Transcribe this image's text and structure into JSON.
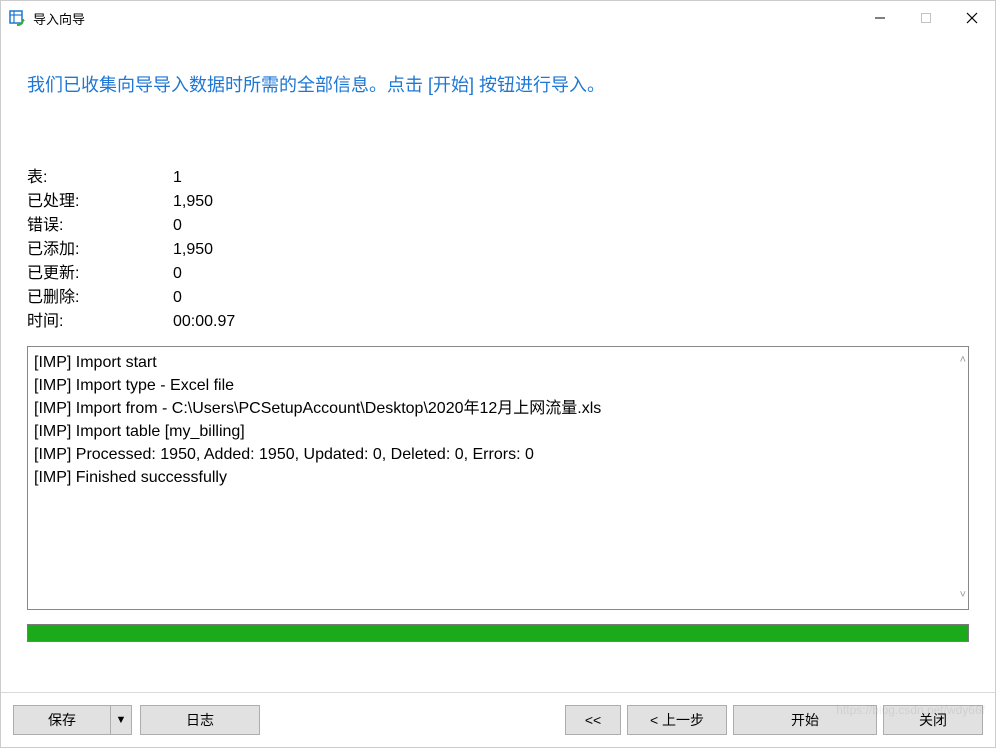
{
  "window": {
    "title": "导入向导"
  },
  "instruction": "我们已收集向导导入数据时所需的全部信息。点击 [开始] 按钮进行导入。",
  "stats": {
    "tables": {
      "label": "表:",
      "value": "1"
    },
    "processed": {
      "label": "已处理:",
      "value": "1,950"
    },
    "errors": {
      "label": "错误:",
      "value": "0"
    },
    "added": {
      "label": "已添加:",
      "value": "1,950"
    },
    "updated": {
      "label": "已更新:",
      "value": "0"
    },
    "deleted": {
      "label": "已删除:",
      "value": "0"
    },
    "time": {
      "label": "时间:",
      "value": "00:00.97"
    }
  },
  "log_lines": [
    "[IMP] Import start",
    "[IMP] Import type - Excel file",
    "[IMP] Import from - C:\\Users\\PCSetupAccount\\Desktop\\2020年12月上网流量.xls",
    "[IMP] Import table [my_billing]",
    "[IMP] Processed: 1950, Added: 1950, Updated: 0, Deleted: 0, Errors: 0",
    "[IMP] Finished successfully"
  ],
  "progress": {
    "percent": 100,
    "color": "#1aaa1a"
  },
  "buttons": {
    "save": "保存",
    "dropdown": "▼",
    "log": "日志",
    "first": "<<",
    "prev": "< 上一步",
    "start": "开始",
    "close": "关闭"
  }
}
